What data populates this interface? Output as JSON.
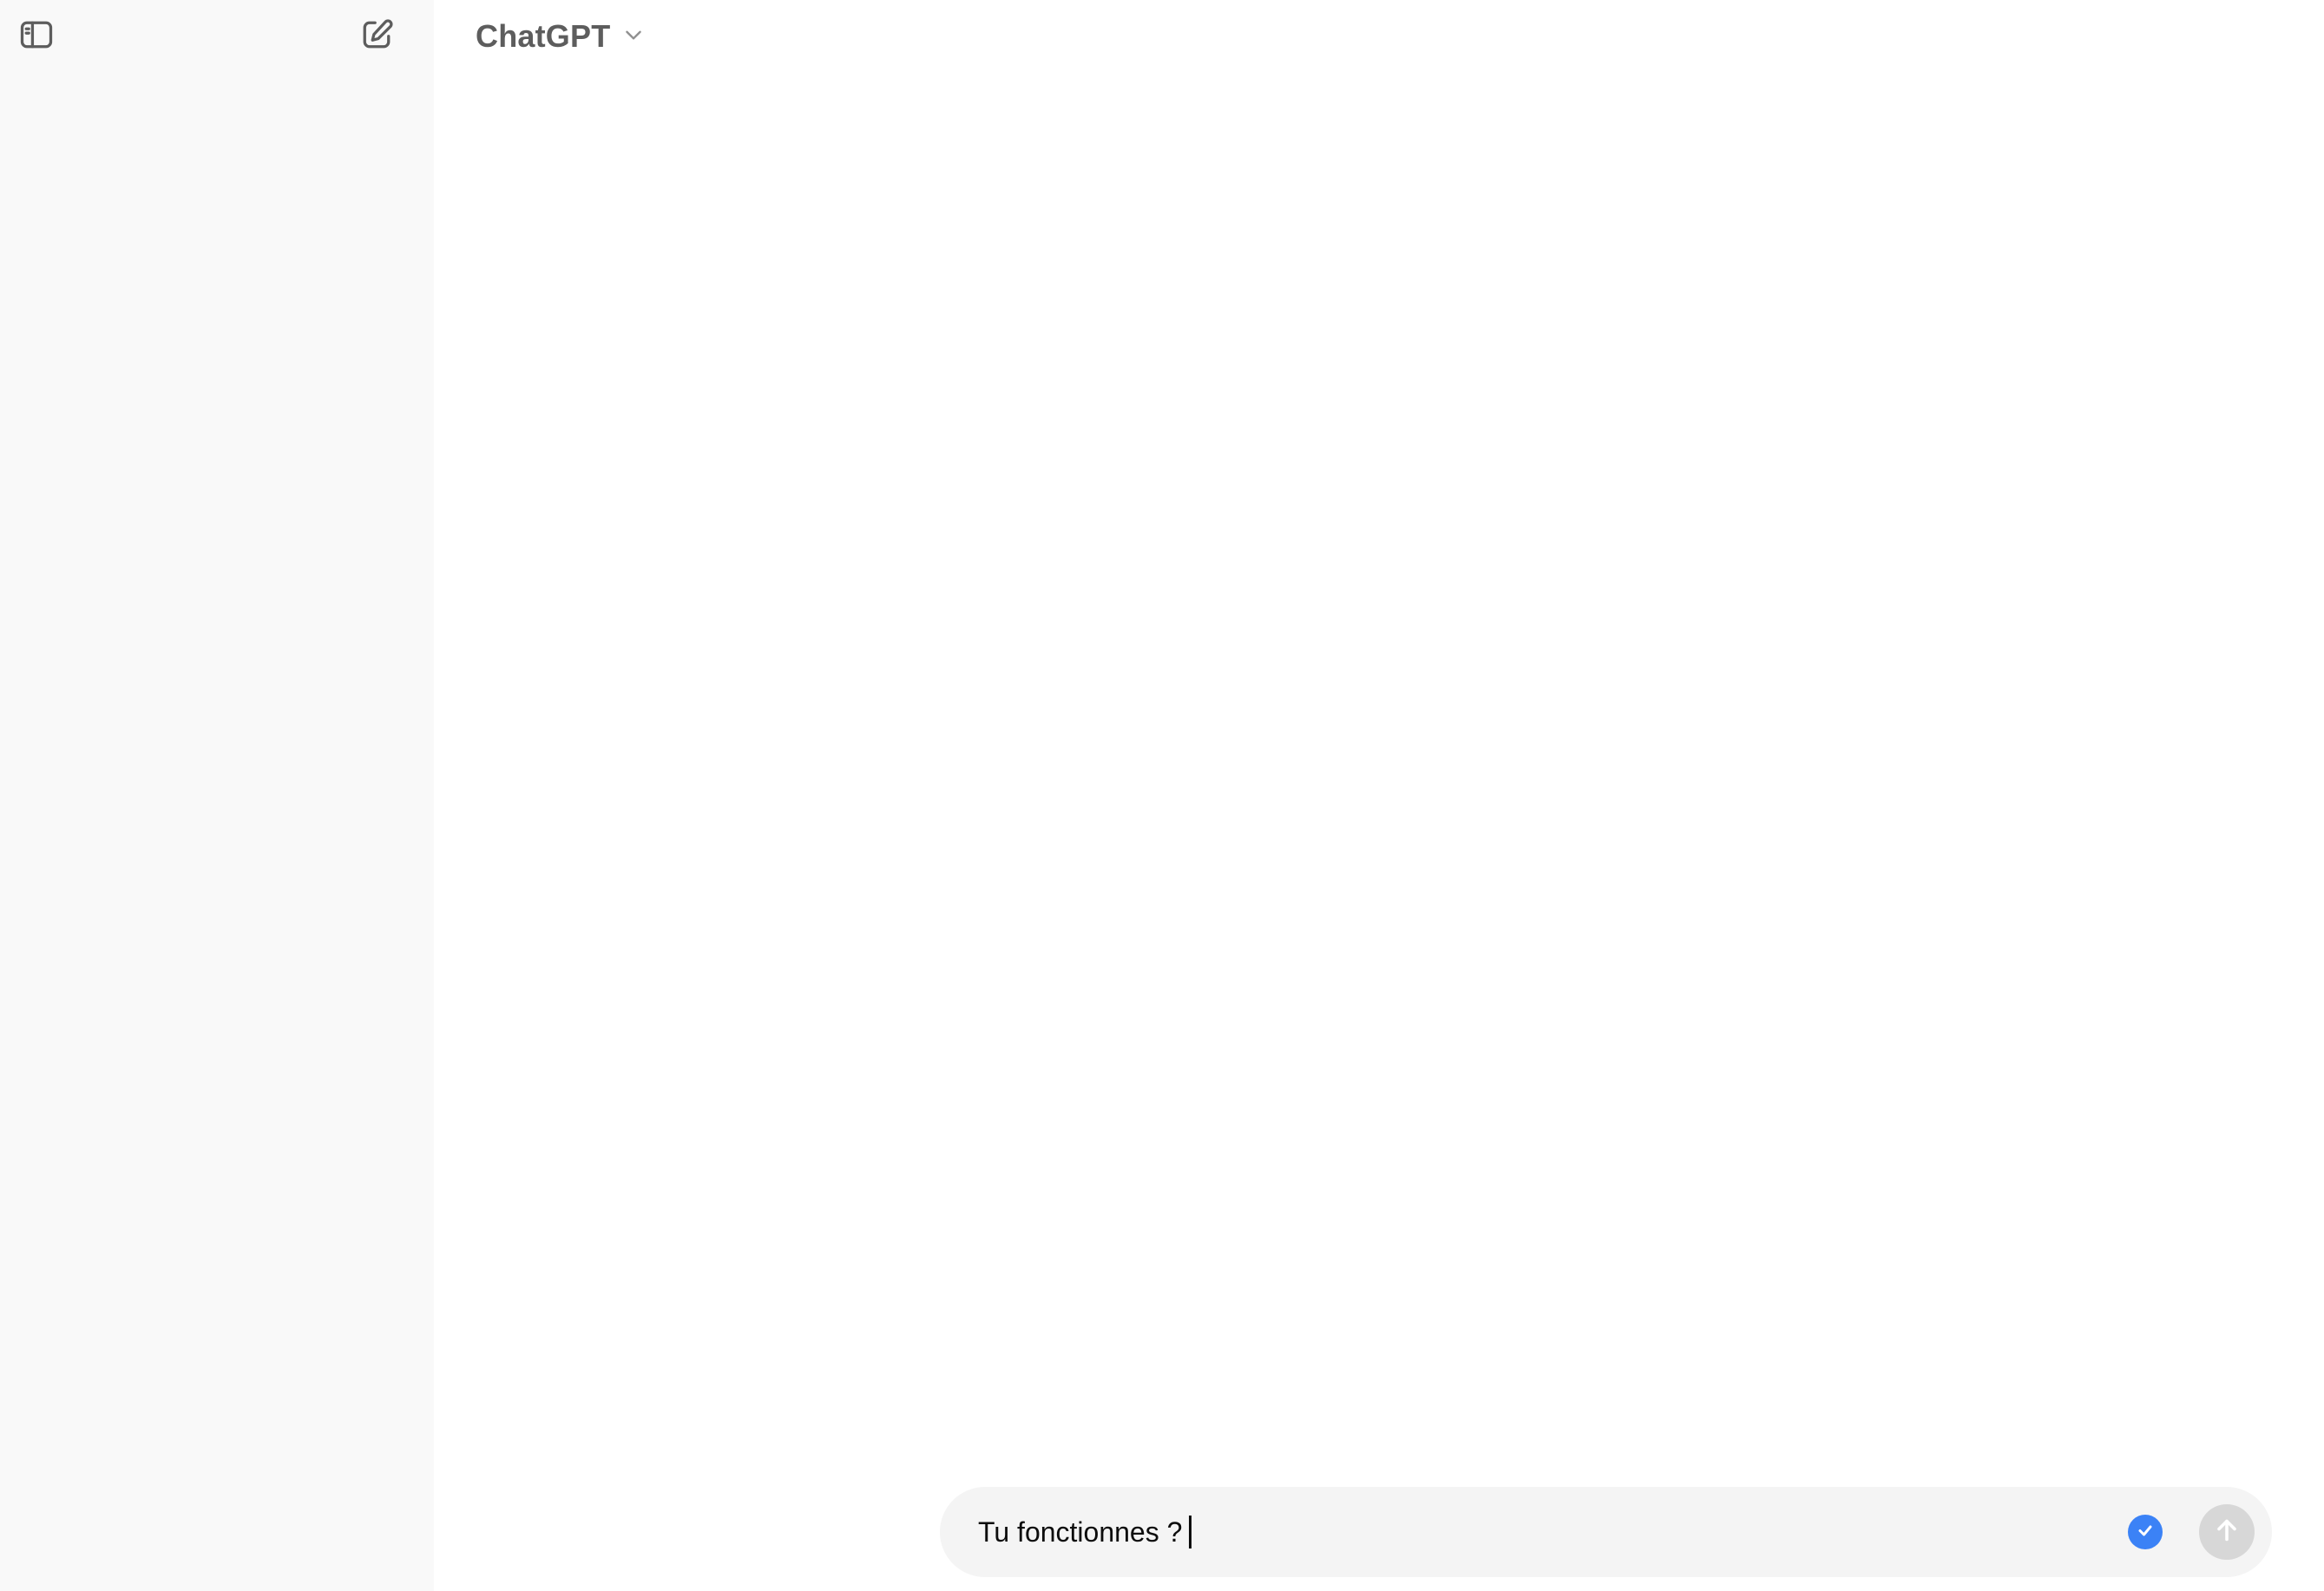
{
  "header": {
    "model_name": "ChatGPT"
  },
  "icons": {
    "sidebar_toggle": "sidebar-toggle-icon",
    "new_chat": "new-chat-icon",
    "model_dropdown": "chevron-down-icon",
    "grammar_check": "check-icon",
    "send": "arrow-up-icon"
  },
  "composer": {
    "value": "Tu fonctionnes ?"
  },
  "colors": {
    "sidebar_bg": "#f9f9f9",
    "composer_bg": "#f4f4f4",
    "check_badge": "#3b82f6",
    "send_disabled": "#d7d7d7"
  }
}
